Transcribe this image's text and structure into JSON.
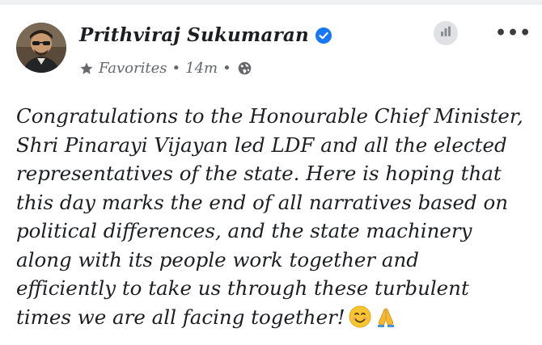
{
  "post": {
    "author": "Prithviraj Sukumaran",
    "audience": "Favorites",
    "separator": "•",
    "time": "14m",
    "body_lines": [
      "Congratulations to the Honourable Chief Minister,",
      "Shri Pinarayi Vijayan led LDF and all the elected",
      "representatives of the state. Here is hoping that",
      "this day marks the end of all narratives based on",
      "political differences, and the state machinery",
      "along with its people work together and",
      "efficiently to take us through these turbulent",
      "times we are all facing together!"
    ],
    "emojis": [
      "smiling-face-icon",
      "folded-hands-icon"
    ]
  },
  "header_actions": {
    "more_label": "•••"
  },
  "colors": {
    "verified_blue": "#1877f2",
    "meta_gray": "#65676b",
    "text": "#1c1e21"
  }
}
